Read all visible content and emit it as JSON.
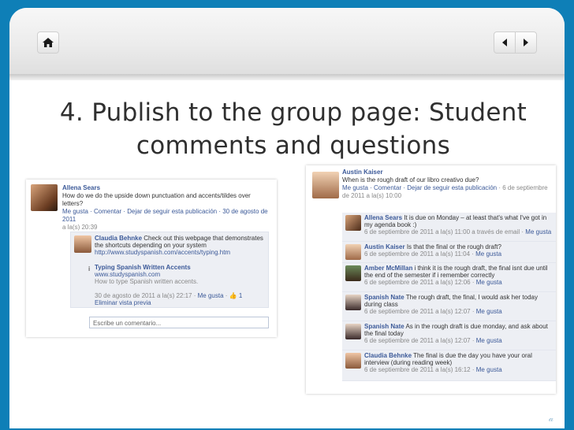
{
  "slide": {
    "title_line1": "4. Publish to the group page: Student",
    "title_line2": "comments and questions",
    "nav": {
      "home_icon": "home-icon",
      "prev_icon": "arrow-left-icon",
      "next_icon": "arrow-right-icon"
    },
    "corner_mark": "𝒶"
  },
  "left_post": {
    "author": "Allena Sears",
    "text": "How do we do the upside down punctuation and accents/tildes over letters?",
    "actions": "Me gusta · Comentar · Dejar de seguir esta publicación · 30 de agosto de 2011",
    "time": "a la(s) 20:39",
    "comment": {
      "author": "Claudia Behnke",
      "text": "Check out this webpage that demonstrates the shortcuts depending on your system",
      "url": "http://www.studyspanish.com/accents/typing.htm",
      "link_title": "Typing Spanish Written Accents",
      "link_domain": "www.studyspanish.com",
      "link_desc": "How to type Spanish written accents.",
      "meta": "30 de agosto de 2011 a la(s) 22:17 ·",
      "like": "Me gusta",
      "likes_count": "1",
      "remove": "Eliminar vista previa"
    },
    "input_placeholder": "Escribe un comentario..."
  },
  "right_post": {
    "author": "Austin Kaiser",
    "text": "When is the rough draft of our libro creativo due?",
    "actions": "Me gusta · Comentar · Dejar de seguir esta publicación",
    "date": "· 6 de septiembre de 2011 a la(s) 10:00",
    "comments": [
      {
        "author": "Allena Sears",
        "text": "It is due on Monday – at least that's what I've got in my agenda book :)",
        "meta": "6 de septiembre de 2011 a la(s) 11:00 a través de email ·",
        "like": "Me gusta"
      },
      {
        "author": "Austin Kaiser",
        "text": "Is that the final or the rough draft?",
        "meta": "6 de septiembre de 2011 a la(s) 11:04 ·",
        "like": "Me gusta"
      },
      {
        "author": "Amber McMillan",
        "text": "i think it is the rough draft, the final isnt due until the end of the semester if i remember correctly",
        "meta": "6 de septiembre de 2011 a la(s) 12:06 ·",
        "like": "Me gusta"
      },
      {
        "author": "Spanish Nate",
        "text": "The rough draft, the final, I would ask her today during class",
        "meta": "6 de septiembre de 2011 a la(s) 12:07 ·",
        "like": "Me gusta"
      },
      {
        "author": "Spanish Nate",
        "text": "As in the rough draft is due monday, and ask about the final today",
        "meta": "6 de septiembre de 2011 a la(s) 12:07 ·",
        "like": "Me gusta"
      },
      {
        "author": "Claudia Behnke",
        "text": "The final is due the day you have your oral interview (during reading week)",
        "meta": "6 de septiembre de 2011 a la(s) 16:12 ·",
        "like": "Me gusta"
      }
    ]
  }
}
